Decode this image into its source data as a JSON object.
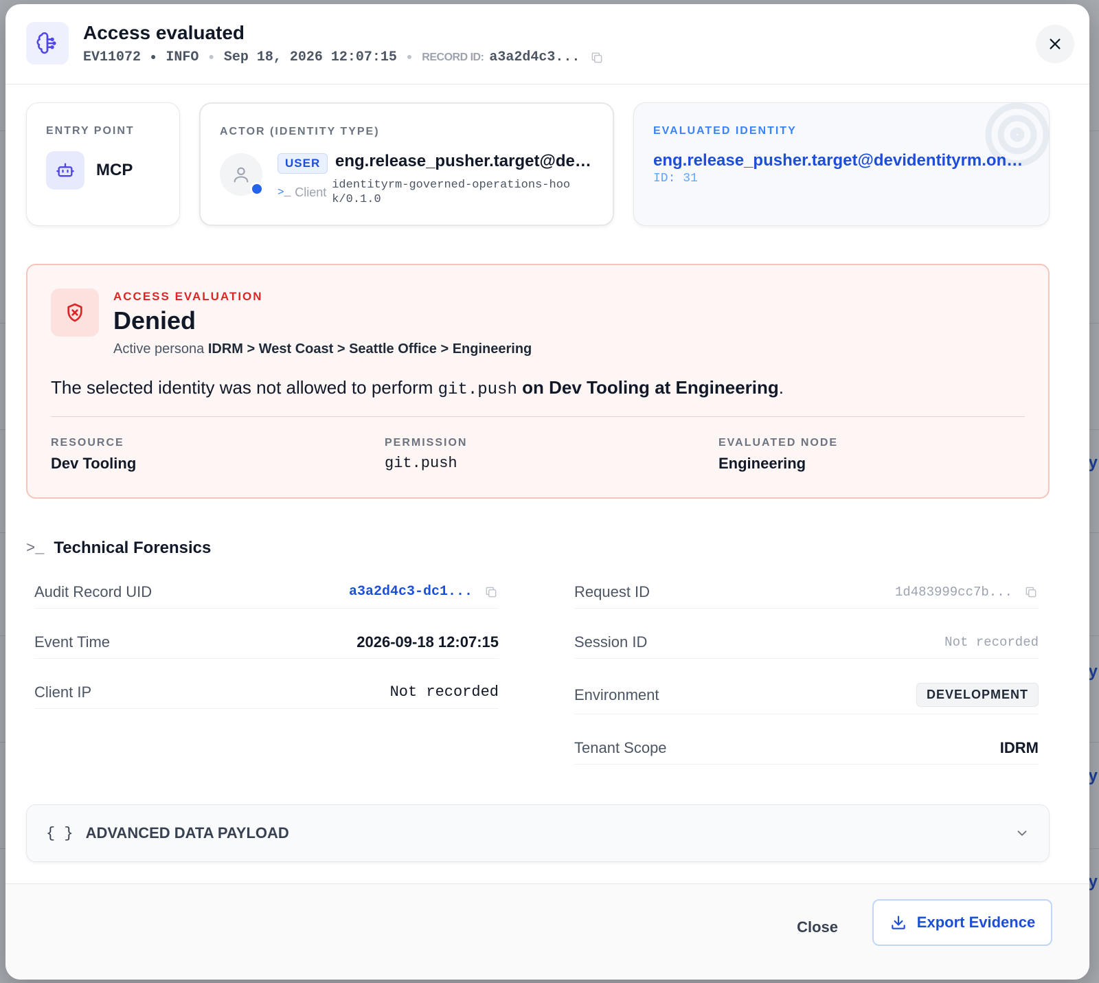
{
  "header": {
    "title": "Access evaluated",
    "event_code": "EV11072",
    "level": "INFO",
    "timestamp": "Sep 18, 2026 12:07:15",
    "record_label": "RECORD ID:",
    "record_value": "a3a2d4c3..."
  },
  "cards": {
    "entry": {
      "label": "ENTRY POINT",
      "value": "MCP"
    },
    "actor": {
      "label": "ACTOR (IDENTITY TYPE)",
      "badge": "USER",
      "name": "eng.release_pusher.target@devi...",
      "client_label": "Client",
      "client_value": "identityrm-governed-operations-hook/0.1.0"
    },
    "evaluated": {
      "label": "EVALUATED IDENTITY",
      "name": "eng.release_pusher.target@devidentityrm.onmi...",
      "id": "ID: 31"
    }
  },
  "evaluation": {
    "eyebrow": "ACCESS EVALUATION",
    "result": "Denied",
    "persona_prefix": "Active persona",
    "persona_path": "IDRM > West Coast > Seattle Office > Engineering",
    "sentence": {
      "part1": "The selected identity was not allowed to perform",
      "permission": "git.push",
      "part2": "on",
      "resource": "Dev Tooling",
      "part3": "at",
      "node": "Engineering",
      "end": "."
    },
    "facts": [
      {
        "label": "RESOURCE",
        "value": "Dev Tooling"
      },
      {
        "label": "PERMISSION",
        "value": "git.push"
      },
      {
        "label": "EVALUATED NODE",
        "value": "Engineering"
      }
    ]
  },
  "forensics": {
    "title": "Technical Forensics",
    "left": [
      {
        "key": "Audit Record UID",
        "value": "a3a2d4c3-dc1..."
      },
      {
        "key": "Event Time",
        "value": "2026-09-18 12:07:15"
      },
      {
        "key": "Client IP",
        "value": "Not recorded"
      }
    ],
    "right": [
      {
        "key": "Request ID",
        "value": "1d483999cc7b..."
      },
      {
        "key": "Session ID",
        "value": "Not recorded"
      },
      {
        "key": "Environment",
        "value": "DEVELOPMENT"
      },
      {
        "key": "Tenant Scope",
        "value": "IDRM"
      }
    ]
  },
  "payload": {
    "braces": "{ }",
    "label": "ADVANCED DATA PAYLOAD"
  },
  "footer": {
    "close_label": "Close",
    "export_label": "Export Evidence"
  },
  "background_fragments": [
    "y",
    "y",
    "y",
    "y"
  ],
  "colors": {
    "accent": "#1d4ed8",
    "danger": "#dc2626",
    "danger_bg": "#fef6f5"
  }
}
